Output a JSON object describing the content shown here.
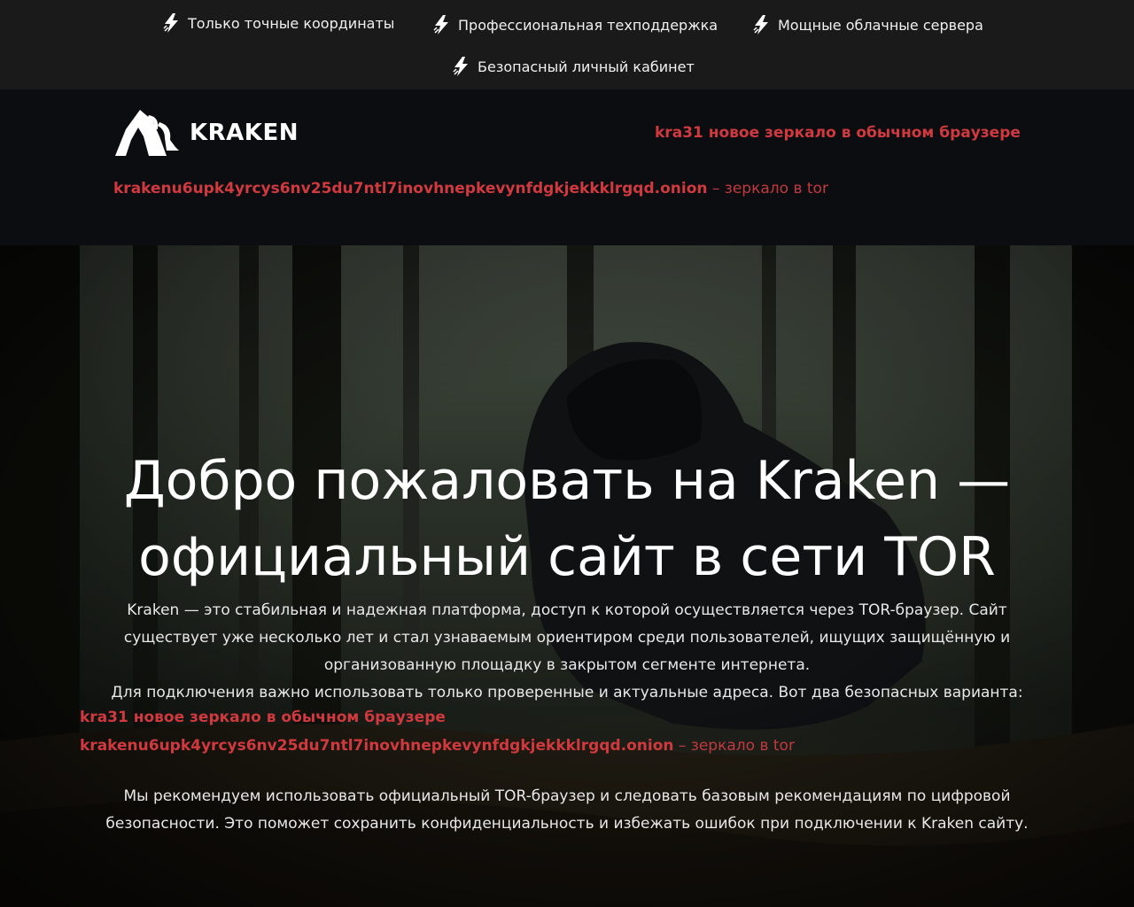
{
  "topbar": {
    "features": [
      {
        "label": "Только точные координаты",
        "icon": "lightning-icon"
      },
      {
        "label": "Профессиональная техподдержка",
        "icon": "lightning-icon"
      },
      {
        "label": "Мощные облачные сервера",
        "icon": "lightning-icon"
      },
      {
        "label": "Безопасный личный кабинет",
        "icon": "lightning-icon"
      }
    ]
  },
  "header": {
    "logo_text": "KRAKEN",
    "mirror_prefix": "kra31",
    "mirror_text": " новое зеркало в обычном браузере",
    "onion_address": "krakenu6upk4yrcys6nv25du7ntl7inovhnepkevynfdgkjekkklrgqd.onion",
    "onion_suffix": " – зеркало в tor"
  },
  "hero": {
    "title_line1": "Добро пожаловать на Kraken —",
    "title_line2": "официальный сайт в сети TOR",
    "paragraph1": "Kraken — это стабильная и надежная платформа, доступ к которой осуществляется через TOR-браузер. Сайт существует уже несколько лет и стал узнаваемым ориентиром среди пользователей, ищущих защищённую и организованную площадку в закрытом сегменте интернета.",
    "paragraph2": "Для подключения важно использовать только проверенные и актуальные адреса. Вот два безопасных варианта:",
    "mirror_prefix": "kra31",
    "mirror_text": " новое зеркало в обычном браузере",
    "onion_address": "krakenu6upk4yrcys6nv25du7ntl7inovhnepkevynfdgkjekkklrgqd.onion",
    "onion_suffix": " – зеркало в tor",
    "paragraph3": "Мы рекомендуем использовать официальный TOR-браузер и следовать базовым рекомендациям по цифровой безопасности. Это поможет сохранить конфиденциальность и избежать ошибок при подключении к Kraken сайту."
  },
  "colors": {
    "accent": "#d0393e",
    "topbar_bg": "#1a1a1a",
    "header_bg": "#0c0d10"
  }
}
